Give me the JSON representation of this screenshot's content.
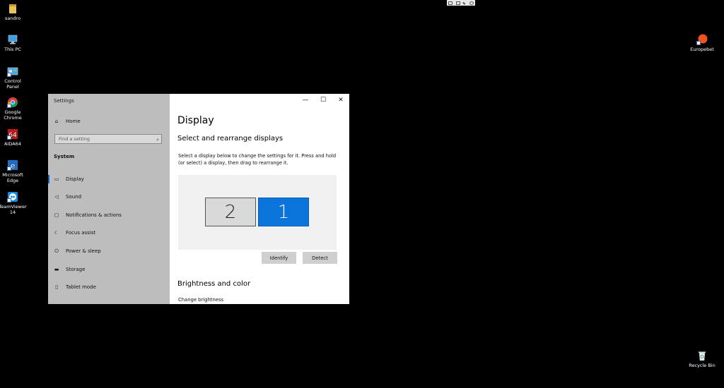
{
  "desktop": {
    "icons": [
      {
        "label": "sandro",
        "icon": "user-folder-icon"
      },
      {
        "label": "This PC",
        "icon": "this-pc-icon"
      },
      {
        "label": "Control Panel",
        "icon": "control-panel-icon"
      },
      {
        "label": "Google Chrome",
        "icon": "chrome-icon"
      },
      {
        "label": "AIDA64",
        "icon": "aida64-icon"
      },
      {
        "label": "Microsoft Edge",
        "icon": "edge-icon"
      },
      {
        "label": "TeamViewer 14",
        "icon": "teamviewer-icon"
      },
      {
        "label": "Europebet",
        "icon": "europebet-icon"
      },
      {
        "label": "Recycle Bin",
        "icon": "recycle-bin-icon"
      }
    ]
  },
  "settings": {
    "window_title": "Settings",
    "caption": {
      "minimize": "—",
      "maximize": "☐",
      "close": "✕"
    },
    "home_label": "Home",
    "search_placeholder": "Find a setting",
    "section_label": "System",
    "nav": [
      {
        "label": "Display",
        "icon": "monitor-icon",
        "selected": true
      },
      {
        "label": "Sound",
        "icon": "speaker-icon"
      },
      {
        "label": "Notifications & actions",
        "icon": "notifications-icon"
      },
      {
        "label": "Focus assist",
        "icon": "moon-icon"
      },
      {
        "label": "Power & sleep",
        "icon": "power-icon"
      },
      {
        "label": "Storage",
        "icon": "storage-icon"
      },
      {
        "label": "Tablet mode",
        "icon": "tablet-icon"
      }
    ],
    "page_title": "Display",
    "subtitle": "Select and rearrange displays",
    "description": "Select a display below to change the settings for it. Press and hold (or select) a display, then drag to rearrange it.",
    "monitors": [
      {
        "number": "2",
        "selected": false
      },
      {
        "number": "1",
        "selected": true
      }
    ],
    "identify_label": "Identify",
    "detect_label": "Detect",
    "brightness_heading": "Brightness and color",
    "change_brightness_label": "Change brightness"
  },
  "colors": {
    "accent": "#0a74da",
    "sidebar_bg": "#bdbdbd",
    "desktop_bg": "#000000"
  }
}
